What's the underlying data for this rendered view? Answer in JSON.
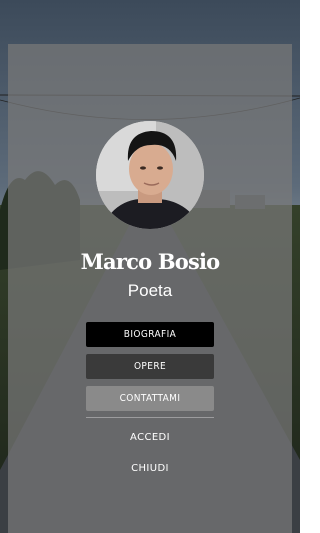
{
  "profile": {
    "name": "Marco Bosio",
    "role": "Poeta"
  },
  "menu": {
    "biografia": "BIOGRAFIA",
    "opere": "OPERE",
    "contattami": "CONTATTAMI",
    "accedi": "ACCEDI",
    "chiudi": "CHIUDI"
  },
  "colors": {
    "panel_overlay": "#787878",
    "button_active": "#000000",
    "button_dark": "#3a3a3a",
    "button_light": "#8a8a8a",
    "text": "#ffffff"
  }
}
